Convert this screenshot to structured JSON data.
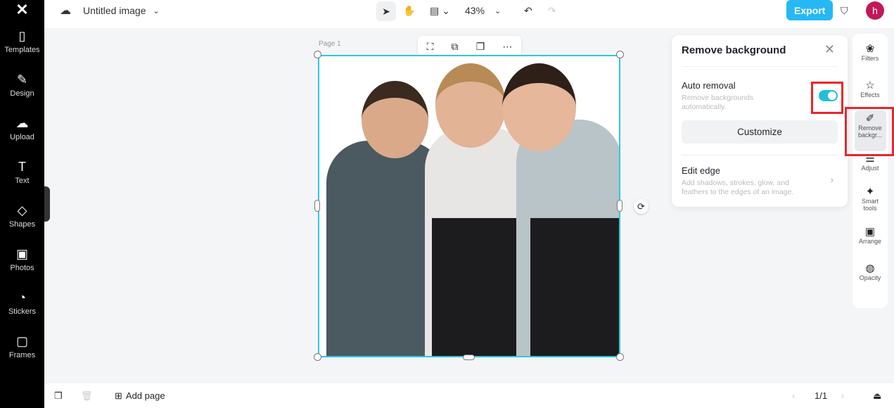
{
  "app": {
    "logo": "CapCut"
  },
  "sidebar": {
    "items": [
      {
        "label": "Templates",
        "icon": "templates-icon",
        "glyph": "▯"
      },
      {
        "label": "Design",
        "icon": "design-icon",
        "glyph": "✎"
      },
      {
        "label": "Upload",
        "icon": "upload-icon",
        "glyph": "☁"
      },
      {
        "label": "Text",
        "icon": "text-icon",
        "glyph": "T"
      },
      {
        "label": "Shapes",
        "icon": "shapes-icon",
        "glyph": "◇"
      },
      {
        "label": "Photos",
        "icon": "photos-icon",
        "glyph": "▣"
      },
      {
        "label": "Stickers",
        "icon": "stickers-icon",
        "glyph": "◔"
      },
      {
        "label": "Frames",
        "icon": "frames-icon",
        "glyph": "▢"
      }
    ]
  },
  "header": {
    "title": "Untitled image",
    "zoom": "43%",
    "export": "Export",
    "avatar": "h"
  },
  "canvas": {
    "page_label": "Page 1"
  },
  "panel": {
    "title": "Remove background",
    "auto_removal": "Auto removal",
    "auto_desc": "Remove backgrounds automatically.",
    "auto_on": true,
    "customize": "Customize",
    "edit_edge": "Edit edge",
    "edge_desc": "Add shadows, strokes, glow, and feathers to the edges of an image."
  },
  "right_tools": [
    {
      "label": "Filters",
      "glyph": "❀"
    },
    {
      "label": "Effects",
      "glyph": "☆"
    },
    {
      "label": "Remove backgr...",
      "glyph": "✐"
    },
    {
      "label": "Adjust",
      "glyph": "⚌"
    },
    {
      "label": "Smart tools",
      "glyph": "✦"
    },
    {
      "label": "Arrange",
      "glyph": "▣"
    },
    {
      "label": "Opacity",
      "glyph": "◍"
    }
  ],
  "footer": {
    "add_page": "Add page",
    "page_count": "1/1"
  },
  "colors": {
    "accent": "#1fc0d6",
    "export": "#25b8f5",
    "highlight": "#e8262b"
  }
}
